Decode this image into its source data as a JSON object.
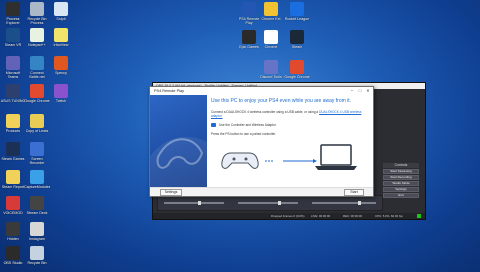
{
  "desktop_icons": [
    {
      "label": "Process Explorer",
      "color": "#2f2f2f"
    },
    {
      "label": "Recycle Bin Process",
      "color": "#aab8c8"
    },
    {
      "label": "SnipIt",
      "color": "#d9e6f4"
    },
    {
      "label": "Steam VR",
      "color": "#1b4f8a"
    },
    {
      "label": "Notepad++",
      "color": "#e8f2e0"
    },
    {
      "label": "IrfanView",
      "color": "#f2e36b"
    },
    {
      "label": "Microsoft Teams",
      "color": "#6162b8"
    },
    {
      "label": "Connect Battle.net",
      "color": "#3585c4"
    },
    {
      "label": "Speccy",
      "color": "#e0581f"
    },
    {
      "label": "ASUS TUNING",
      "color": "#2c3f6f"
    },
    {
      "label": "Google Chrome",
      "color": "#e14a2f"
    },
    {
      "label": "Twitch",
      "color": "#8a52cc"
    },
    {
      "label": "Products",
      "color": "#f0d25a"
    },
    {
      "label": "Copy of Lewis",
      "color": "#e8cc55"
    },
    {
      "label": "Steam Games",
      "color": "#1c2f55"
    },
    {
      "label": "Screen Recorder",
      "color": "#3b6fd1"
    },
    {
      "label": "Steam Report",
      "color": "#f0d25a"
    },
    {
      "label": "CaptureModules",
      "color": "#3aa1e8"
    },
    {
      "label": "VOICEMOD",
      "color": "#d83a3a"
    },
    {
      "label": "Stream Deck",
      "color": "#444"
    },
    {
      "label": "Hidden",
      "color": "#3a3a3a"
    },
    {
      "label": "Instagram",
      "color": "#d6d6d6"
    },
    {
      "label": "OBS Studio",
      "color": "#2b2b2b"
    },
    {
      "label": "Recycle Bin",
      "color": "#c5d2df"
    },
    {
      "label": "PS4 Remote Play",
      "color": "#2456b3"
    },
    {
      "label": "Chrome Ext",
      "color": "#f1c232"
    },
    {
      "label": "Rocket League",
      "color": "#1b6ee0"
    },
    {
      "label": "Epic Games",
      "color": "#2a2a2a"
    },
    {
      "label": "Chrome",
      "color": "#ffffff"
    },
    {
      "label": "Steam",
      "color": "#1b2838"
    },
    {
      "label": "Discord Tools",
      "color": "#6674c7"
    },
    {
      "label": "Google Chrome",
      "color": "#e14a2f"
    },
    {
      "label": "Rapid Racing",
      "color": "#c3372c"
    }
  ],
  "obs": {
    "title": "OBS 26.0.2 (64-bit, windows) - Profile: Untitled - Scenes: Untitled",
    "controls_header": "Controls",
    "buttons": [
      "Start Streaming",
      "Start Recording",
      "Studio Mode",
      "Settings",
      "Exit"
    ],
    "status": {
      "dropped": "Dropped Frames 0 (0.0%)",
      "live": "LIVE: 00:00:00",
      "rec": "REC: 00:00:00",
      "cpu": "CPU: 5.0%, 60.00 fps"
    }
  },
  "dialog": {
    "title": "PS4 Remote Play",
    "heading": "Use this PC to enjoy your PS4 even while you are away from it.",
    "instruction": "Connect a DUALSHOCK 4 wireless controller using a USB cable, or using a",
    "link": "DUALSHOCK 4 USB wireless adaptor.",
    "option": "Use the Controller and Wireless Adaptor",
    "press": "Press the PS button to use a paired controller.",
    "settings_button": "Settings",
    "start_button": "Start",
    "colors": {
      "accent": "#1f6bd1",
      "side": "#2456b3"
    }
  }
}
